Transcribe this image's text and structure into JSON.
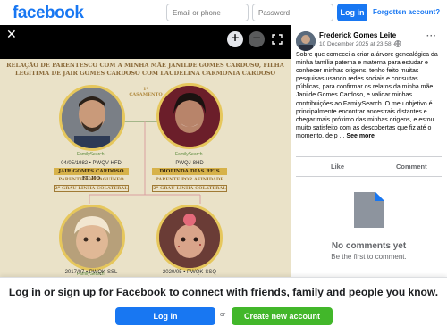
{
  "header": {
    "logo": "facebook",
    "email_placeholder": "Email or phone",
    "password_placeholder": "Password",
    "login_label": "Log in",
    "forgot_label": "Forgotten account?"
  },
  "viewer": {
    "icons": [
      "close-icon",
      "zoom-in-icon",
      "zoom-out-icon",
      "fullscreen-icon"
    ],
    "photo": {
      "heading_line1": "RELAÇÃO DE PARENTESCO COM A MINHA MÃE JANILDE GOMES CARDOSO, FILHA",
      "heading_line2": "LEGÍTIMA DE JAIR GOMES CARDOSO COM LAUDELINA CARMONIA CARDOSO",
      "marriage_caption": "1º CASAMENTO",
      "familysearch": "FamilySearch",
      "person1": {
        "id": "04/05/1982 • PWQV-HFD",
        "name": "JAIR GOMES CARDOSO FILHO",
        "relation": "PARENTE CONSAGUÍNEO",
        "degree": "2º GRAU LINHA COLATERAL"
      },
      "person2": {
        "id": "PWQJ-8HD",
        "name": "DIOLINDA DIAS REIS",
        "relation": "PARENTE POR AFINIDADE",
        "degree": "2º GRAU LINHA COLATERAL"
      },
      "person3": {
        "id": "2017/07 • PWQK-SSL"
      },
      "person4": {
        "id": "2020/05 • PWQK-SSQ"
      }
    }
  },
  "post": {
    "author": "Frederick Gomes Leite",
    "date": "10 December 2025 at 23:58 ·",
    "more": "···",
    "text": "Sobre que comecei a criar a árvore genealógica da minha família paterna e materna para estudar e conhecer minhas origens, tenho feito muitas pesquisas usando redes sociais e consultas públicas, para confirmar os relatos da minha mãe Janilde Gomes Cardoso, e validar minhas contribuições ao FamilySearch. O meu objetivo é principalmente encontrar ancestrais distantes e chegar mais próximo das minhas origens, e estou muito satisfeito com as descobertas que fiz até o momento, de p ...",
    "see_more": "See more",
    "like_label": "Like",
    "comment_label": "Comment",
    "no_comments": "No comments yet",
    "be_first": "Be the first to comment."
  },
  "banner": {
    "text": "Log in or sign up for Facebook to connect with friends, family and people you know.",
    "login_label": "Log in",
    "or_label": "or",
    "create_label": "Create new account"
  },
  "colors": {
    "brand": "#1877f2",
    "create_green": "#42b72a",
    "photo_bg": "#eae2c8",
    "gold": "#d7b24a"
  }
}
